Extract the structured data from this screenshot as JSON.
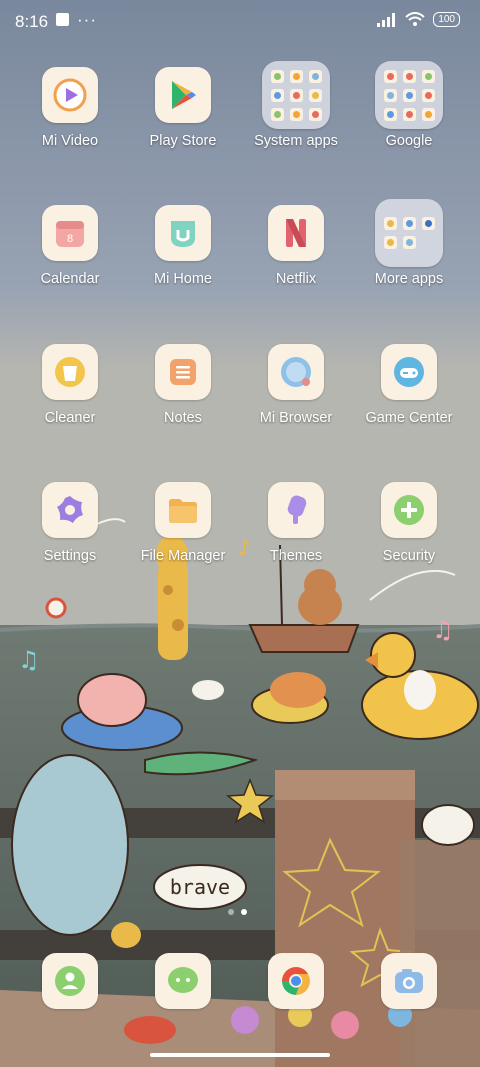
{
  "status_bar": {
    "time": "8:16",
    "notification_dots": "···",
    "battery": "100"
  },
  "apps": [
    {
      "label": "Mi Video",
      "icon": "mi-video-icon"
    },
    {
      "label": "Play Store",
      "icon": "play-store-icon"
    },
    {
      "label": "System apps",
      "icon": "folder-icon"
    },
    {
      "label": "Google",
      "icon": "folder-icon"
    },
    {
      "label": "Calendar",
      "icon": "calendar-icon",
      "calendar_day": "8"
    },
    {
      "label": "Mi Home",
      "icon": "mi-home-icon"
    },
    {
      "label": "Netflix",
      "icon": "netflix-icon"
    },
    {
      "label": "More apps",
      "icon": "folder-icon"
    },
    {
      "label": "Cleaner",
      "icon": "trash-icon"
    },
    {
      "label": "Notes",
      "icon": "notes-icon"
    },
    {
      "label": "Mi Browser",
      "icon": "browser-icon"
    },
    {
      "label": "Game Center",
      "icon": "gamepad-icon"
    },
    {
      "label": "Settings",
      "icon": "gear-icon"
    },
    {
      "label": "File Manager",
      "icon": "folder-icon"
    },
    {
      "label": "Themes",
      "icon": "brush-icon"
    },
    {
      "label": "Security",
      "icon": "shield-plus-icon"
    }
  ],
  "dock": [
    {
      "name": "Phone",
      "icon": "phone-icon"
    },
    {
      "name": "Messages",
      "icon": "messages-icon"
    },
    {
      "name": "Chrome",
      "icon": "chrome-icon"
    },
    {
      "name": "Camera",
      "icon": "camera-icon"
    }
  ],
  "wallpaper": {
    "speech_bubble_text": "brave"
  },
  "pages": {
    "count": 2,
    "current": 2
  },
  "colors": {
    "tile": "#fbf1e2",
    "sky": "#8e9ab0",
    "sea": "#5d6a62"
  }
}
